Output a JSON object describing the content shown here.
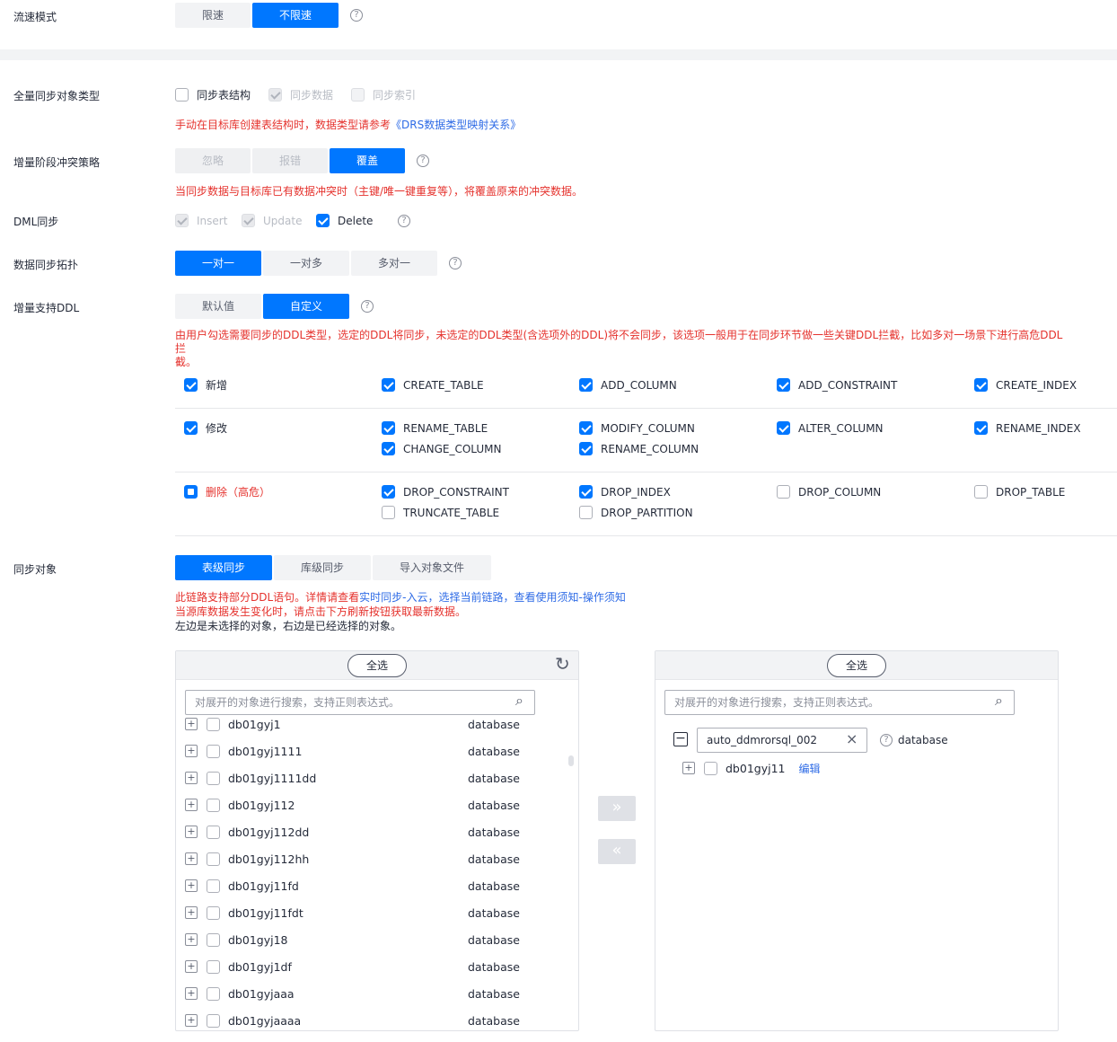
{
  "flow_mode": {
    "label": "流速模式",
    "options": [
      "限速",
      "不限速"
    ]
  },
  "full_sync": {
    "label": "全量同步对象类型",
    "options": [
      "同步表结构",
      "同步数据",
      "同步索引"
    ],
    "hint_prefix": "手动在目标库创建表结构时，数据类型请参考",
    "hint_link": "《DRS数据类型映射关系》"
  },
  "conflict": {
    "label": "增量阶段冲突策略",
    "options": [
      "忽略",
      "报错",
      "覆盖"
    ],
    "hint": "当同步数据与目标库已有数据冲突时（主键/唯一键重复等），将覆盖原来的冲突数据。"
  },
  "dml": {
    "label": "DML同步",
    "options": [
      "Insert",
      "Update",
      "Delete"
    ]
  },
  "topology": {
    "label": "数据同步拓扑",
    "options": [
      "一对一",
      "一对多",
      "多对一"
    ]
  },
  "ddl": {
    "label": "增量支持DDL",
    "options": [
      "默认值",
      "自定义"
    ],
    "hint_line1": "由用户勾选需要同步的DDL类型，选定的DDL将同步，未选定的DDL类型(含选项外的DDL)将不会同步，该选项一般用于在同步环节做一些关键DDL拦截，比如多对一场景下进行高危DDL拦",
    "hint_line2": "截。",
    "groups": [
      {
        "name": "新增",
        "items": [
          "CREATE_TABLE",
          "ADD_COLUMN",
          "ADD_CONSTRAINT",
          "CREATE_INDEX"
        ]
      },
      {
        "name": "修改",
        "items": [
          "RENAME_TABLE",
          "MODIFY_COLUMN",
          "ALTER_COLUMN",
          "RENAME_INDEX",
          "CHANGE_COLUMN",
          "RENAME_COLUMN"
        ]
      },
      {
        "name": "删除（高危）",
        "items": [
          "DROP_CONSTRAINT",
          "DROP_INDEX",
          "DROP_COLUMN",
          "DROP_TABLE",
          "TRUNCATE_TABLE",
          "DROP_PARTITION"
        ]
      }
    ]
  },
  "sync_obj": {
    "label": "同步对象",
    "options": [
      "表级同步",
      "库级同步",
      "导入对象文件"
    ],
    "hint1_prefix": "此链路支持部分DDL语句。详情请查看",
    "hint1_link": "实时同步-入云，选择当前链路，查看使用须知-操作须知",
    "hint2": "当源库数据发生变化时，请点击下方刷新按钮获取最新数据。",
    "hint3": "左边是未选择的对象，右边是已经选择的对象。"
  },
  "left_panel": {
    "select_all": "全选",
    "search_placeholder": "对展开的对象进行搜索，支持正则表达式。",
    "rows": [
      {
        "name": "db01gyj1",
        "type": "database"
      },
      {
        "name": "db01gyj1111",
        "type": "database"
      },
      {
        "name": "db01gyj1111dd",
        "type": "database"
      },
      {
        "name": "db01gyj112",
        "type": "database"
      },
      {
        "name": "db01gyj112dd",
        "type": "database"
      },
      {
        "name": "db01gyj112hh",
        "type": "database"
      },
      {
        "name": "db01gyj11fd",
        "type": "database"
      },
      {
        "name": "db01gyj11fdt",
        "type": "database"
      },
      {
        "name": "db01gyj18",
        "type": "database"
      },
      {
        "name": "db01gyj1df",
        "type": "database"
      },
      {
        "name": "db01gyjaaa",
        "type": "database"
      },
      {
        "name": "db01gyjaaaa",
        "type": "database"
      }
    ]
  },
  "right_panel": {
    "select_all": "全选",
    "search_placeholder": "对展开的对象进行搜索，支持正则表达式。",
    "root_value": "auto_ddmrorsql_002",
    "root_type": "database",
    "child_name": "db01gyj11",
    "child_edit": "编辑"
  },
  "icons": {
    "help": "?",
    "refresh": "↻",
    "search": "⌕",
    "move_right": "»",
    "move_left": "«",
    "clear": "×"
  }
}
